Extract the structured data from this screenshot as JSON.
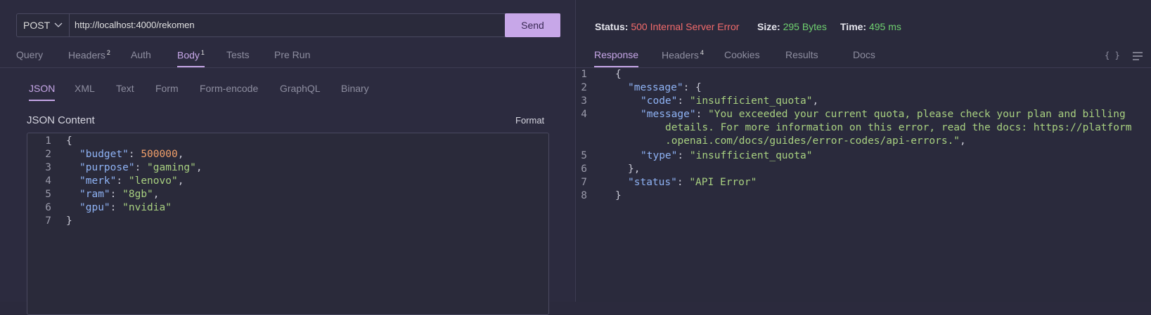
{
  "request": {
    "method": "POST",
    "url": "http://localhost:4000/rekomen",
    "send_label": "Send",
    "tabs": [
      {
        "label": "Query"
      },
      {
        "label": "Headers",
        "badge": "2"
      },
      {
        "label": "Auth"
      },
      {
        "label": "Body",
        "badge": "1"
      },
      {
        "label": "Tests"
      },
      {
        "label": "Pre Run"
      }
    ],
    "body_tabs": [
      "JSON",
      "XML",
      "Text",
      "Form",
      "Form-encode",
      "GraphQL",
      "Binary"
    ],
    "json_title": "JSON Content",
    "format_label": "Format",
    "line_numbers": [
      "1",
      "2",
      "3",
      "4",
      "5",
      "6",
      "7"
    ],
    "body_lines": {
      "l1": "{",
      "budget_key": "\"budget\"",
      "budget_val": "500000",
      "purpose_key": "\"purpose\"",
      "purpose_val": "\"gaming\"",
      "merk_key": "\"merk\"",
      "merk_val": "\"lenovo\"",
      "ram_key": "\"ram\"",
      "ram_val": "\"8gb\"",
      "gpu_key": "\"gpu\"",
      "gpu_val": "\"nvidia\"",
      "l7": "}"
    }
  },
  "response": {
    "status_label": "Status:",
    "status_value": "500 Internal Server Error",
    "size_label": "Size:",
    "size_value": "295 Bytes",
    "time_label": "Time:",
    "time_value": "495 ms",
    "tabs": [
      {
        "label": "Response"
      },
      {
        "label": "Headers",
        "badge": "4"
      },
      {
        "label": "Cookies"
      },
      {
        "label": "Results"
      },
      {
        "label": "Docs"
      }
    ],
    "braces_icon_text": "{ }",
    "line_numbers": [
      "1",
      "2",
      "3",
      "4",
      "",
      "",
      "5",
      "6",
      "7",
      "8"
    ],
    "lines": {
      "l1": "{",
      "message_key": "\"message\"",
      "l2_tail": ": {",
      "code_key": "\"code\"",
      "code_val": "\"insufficient_quota\"",
      "msg_key": "\"message\"",
      "msg_val_1": "\"You exceeded your current quota, please check your plan and billing",
      "msg_val_2": "details. For more information on this error, read the docs: https://platform",
      "msg_val_3": ".openai.com/docs/guides/error-codes/api-errors.\"",
      "type_key": "\"type\"",
      "type_val": "\"insufficient_quota\"",
      "l6": "},",
      "status_key": "\"status\"",
      "status_val": "\"API Error\"",
      "l8": "}"
    }
  },
  "colors": {
    "accent": "#c7a7e8",
    "error": "#f26b6b",
    "success": "#6fd06f",
    "json_key": "#8fb3f5",
    "json_string": "#a8d080",
    "json_number": "#f2a06a"
  }
}
